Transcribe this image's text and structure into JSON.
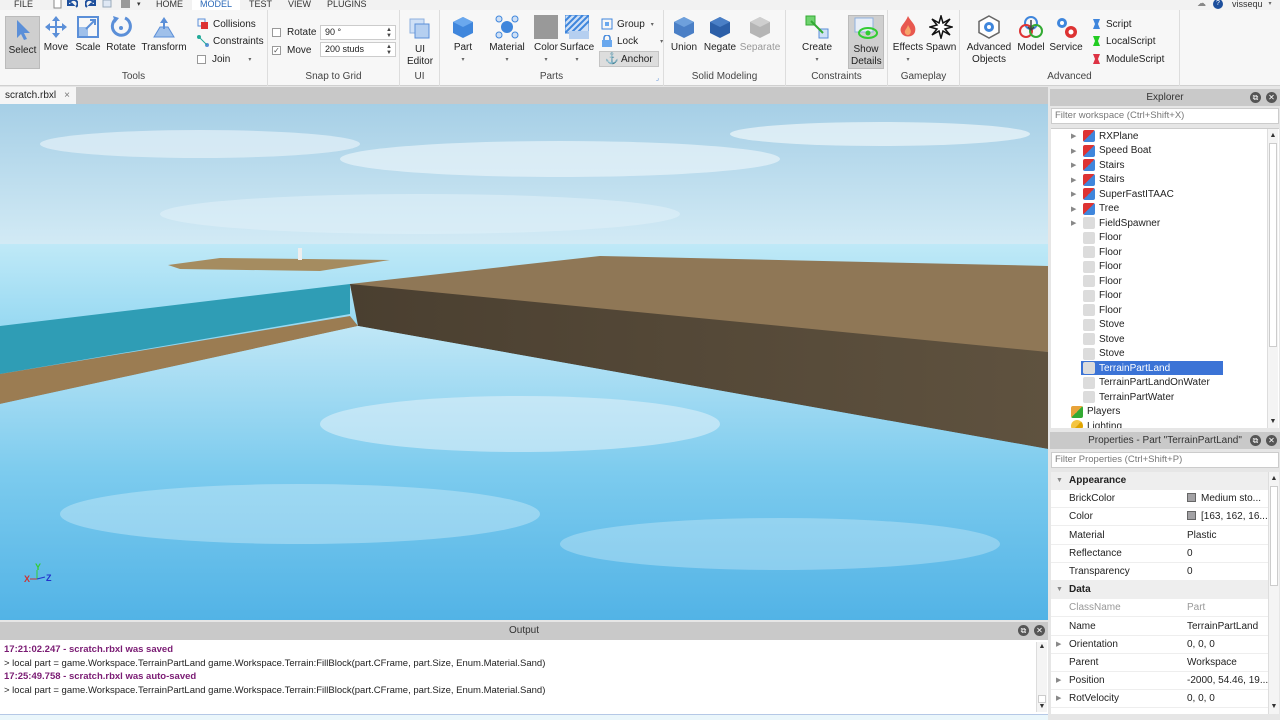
{
  "menu": {
    "file": "FILE",
    "tabs": [
      "HOME",
      "MODEL",
      "TEST",
      "VIEW",
      "PLUGINS"
    ],
    "active_tab": "MODEL",
    "user": "vissequ"
  },
  "ribbon": {
    "tools": {
      "label": "Tools",
      "buttons": [
        "Select",
        "Move",
        "Scale",
        "Rotate",
        "Transform"
      ],
      "collisions": "Collisions",
      "constraints": "Constraints",
      "join": "Join"
    },
    "snap": {
      "label": "Snap to Grid",
      "rotate_label": "Rotate",
      "rotate_checked": false,
      "rotate_value": "90 °",
      "move_label": "Move",
      "move_checked": true,
      "move_value": "200 studs"
    },
    "ui": {
      "label": "UI",
      "button": "UI Editor"
    },
    "parts": {
      "label": "Parts",
      "buttons": [
        "Part",
        "Material",
        "Color",
        "Surface"
      ],
      "group": "Group",
      "lock": "Lock",
      "anchor": "Anchor"
    },
    "solid": {
      "label": "Solid Modeling",
      "buttons": [
        "Union",
        "Negate",
        "Separate"
      ]
    },
    "constraints": {
      "label": "Constraints",
      "create": "Create",
      "show_details": "Show Details"
    },
    "gameplay": {
      "label": "Gameplay",
      "buttons": [
        "Effects",
        "Spawn"
      ]
    },
    "advanced": {
      "label": "Advanced",
      "buttons": [
        "Advanced Objects",
        "Model",
        "Service"
      ],
      "scripts": [
        "Script",
        "LocalScript",
        "ModuleScript"
      ]
    }
  },
  "document_tab": {
    "name": "scratch.rbxl",
    "close": "×"
  },
  "viewport": {
    "axis_x": "X",
    "axis_y": "Y",
    "axis_z": "Z"
  },
  "output": {
    "title": "Output",
    "lines": [
      {
        "type": "timestamp",
        "text": "17:21:02.247 - scratch.rbxl was saved"
      },
      {
        "type": "command",
        "text": "> local part = game.Workspace.TerrainPartLand game.Workspace.Terrain:FillBlock(part.CFrame, part.Size, Enum.Material.Sand)"
      },
      {
        "type": "timestamp",
        "text": "17:25:49.758 - scratch.rbxl was auto-saved"
      },
      {
        "type": "command",
        "text": "> local part = game.Workspace.TerrainPartLand game.Workspace.Terrain:FillBlock(part.CFrame, part.Size, Enum.Material.Sand)"
      }
    ]
  },
  "explorer": {
    "title": "Explorer",
    "filter_placeholder": "Filter workspace (Ctrl+Shift+X)",
    "items": [
      {
        "name": "RXPlane",
        "icon": "model",
        "expandable": true
      },
      {
        "name": "Speed Boat",
        "icon": "model",
        "expandable": true
      },
      {
        "name": "Stairs",
        "icon": "model",
        "expandable": true
      },
      {
        "name": "Stairs",
        "icon": "model",
        "expandable": true
      },
      {
        "name": "SuperFastITAAC",
        "icon": "model",
        "expandable": true
      },
      {
        "name": "Tree",
        "icon": "model",
        "expandable": true
      },
      {
        "name": "FieldSpawner",
        "icon": "part",
        "expandable": true
      },
      {
        "name": "Floor",
        "icon": "part",
        "expandable": false
      },
      {
        "name": "Floor",
        "icon": "part",
        "expandable": false
      },
      {
        "name": "Floor",
        "icon": "part",
        "expandable": false
      },
      {
        "name": "Floor",
        "icon": "part",
        "expandable": false
      },
      {
        "name": "Floor",
        "icon": "part",
        "expandable": false
      },
      {
        "name": "Floor",
        "icon": "part",
        "expandable": false
      },
      {
        "name": "Stove",
        "icon": "part",
        "expandable": false
      },
      {
        "name": "Stove",
        "icon": "part",
        "expandable": false
      },
      {
        "name": "Stove",
        "icon": "part",
        "expandable": false
      },
      {
        "name": "TerrainPartLand",
        "icon": "part",
        "expandable": false,
        "selected": true
      },
      {
        "name": "TerrainPartLandOnWater",
        "icon": "part",
        "expandable": false
      },
      {
        "name": "TerrainPartWater",
        "icon": "part",
        "expandable": false
      },
      {
        "name": "Players",
        "icon": "players",
        "expandable": false,
        "level": 0
      },
      {
        "name": "Lighting",
        "icon": "lighting",
        "expandable": false,
        "level": 0
      }
    ]
  },
  "properties": {
    "title": "Properties - Part \"TerrainPartLand\"",
    "filter_placeholder": "Filter Properties (Ctrl+Shift+P)",
    "rows": [
      {
        "kind": "category",
        "name": "Appearance"
      },
      {
        "name": "BrickColor",
        "value": "Medium sto...",
        "swatch": "#a3a2a5"
      },
      {
        "name": "Color",
        "value": "[163, 162, 16...",
        "swatch": "#a3a2a5"
      },
      {
        "name": "Material",
        "value": "Plastic"
      },
      {
        "name": "Reflectance",
        "value": "0"
      },
      {
        "name": "Transparency",
        "value": "0"
      },
      {
        "kind": "category",
        "name": "Data"
      },
      {
        "name": "ClassName",
        "value": "Part",
        "readonly": true
      },
      {
        "name": "Name",
        "value": "TerrainPartLand"
      },
      {
        "name": "Orientation",
        "value": "0, 0, 0",
        "expandable": true
      },
      {
        "name": "Parent",
        "value": "Workspace"
      },
      {
        "name": "Position",
        "value": "-2000, 54.46, 19...",
        "expandable": true
      },
      {
        "name": "RotVelocity",
        "value": "0, 0, 0",
        "expandable": true
      }
    ]
  },
  "colors": {
    "accent": "#2a68b8",
    "selection": "#3b73d6",
    "output_timestamp": "#7a1b73"
  }
}
